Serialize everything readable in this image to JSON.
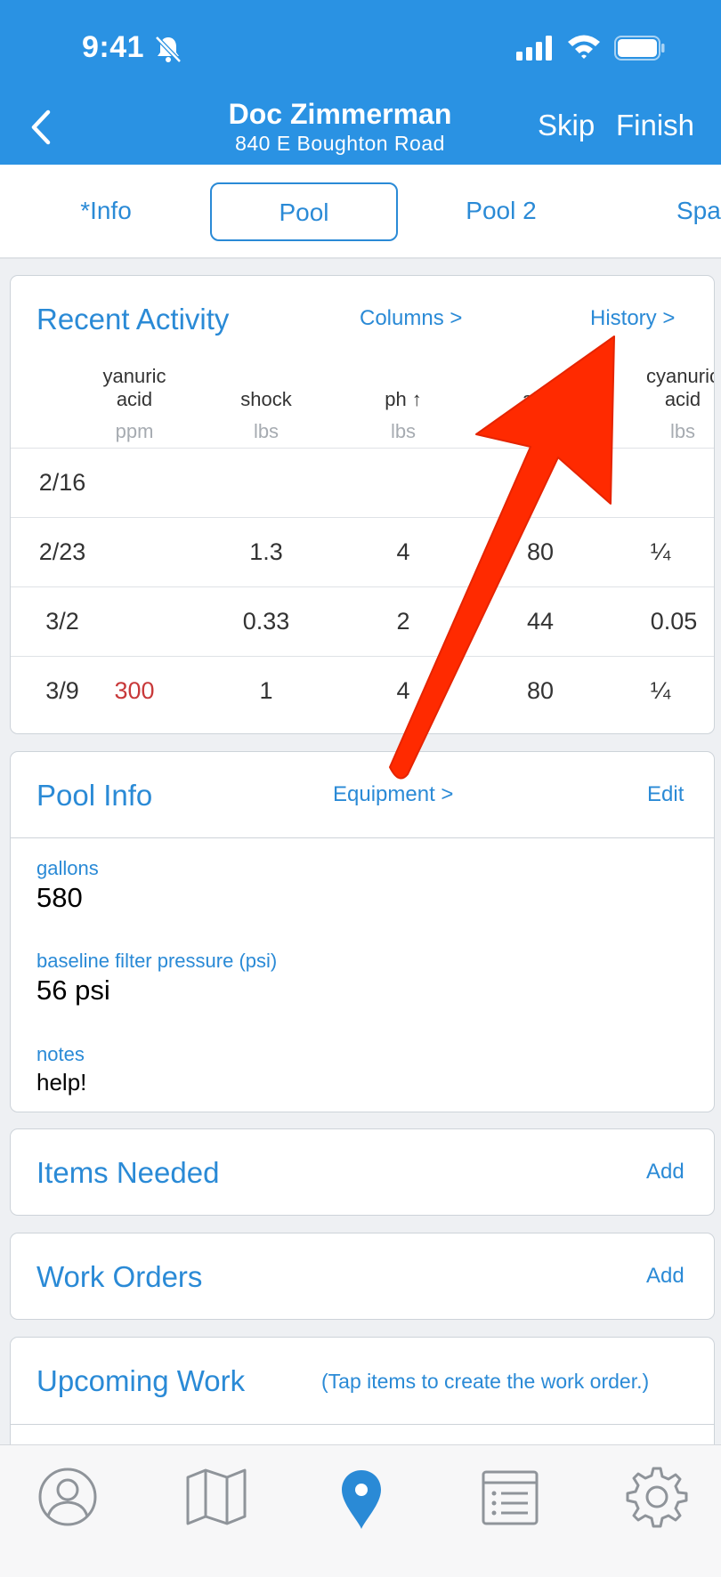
{
  "status_bar": {
    "time": "9:41"
  },
  "header": {
    "title": "Doc Zimmerman",
    "subtitle": "840 E Boughton Road",
    "skip_label": "Skip",
    "finish_label": "Finish"
  },
  "tabs": [
    "*Info",
    "Pool",
    "Pool 2",
    "Spa"
  ],
  "recent_activity": {
    "title": "Recent Activity",
    "columns_link": "Columns >",
    "history_link": "History >",
    "columns": [
      {
        "name_line1": "yanuric",
        "name_line2": "acid",
        "unit": "ppm"
      },
      {
        "name_line1": "",
        "name_line2": "shock",
        "unit": "lbs"
      },
      {
        "name_line1": "",
        "name_line2": "ph ↑",
        "unit": "lbs"
      },
      {
        "name_line1": "",
        "name_line2": "alka",
        "unit": ""
      },
      {
        "name_line1": "cyanuric",
        "name_line2": "acid",
        "unit": "lbs"
      }
    ],
    "rows": [
      {
        "date": "2/16",
        "c1": "",
        "c2": "",
        "c3": "",
        "c4": "",
        "c5": ""
      },
      {
        "date": "2/23",
        "c1": "",
        "c2": "1.3",
        "c3": "4",
        "c4": "80",
        "c5": "¼"
      },
      {
        "date": "3/2",
        "c1": "",
        "c2": "0.33",
        "c3": "2",
        "c4": "44",
        "c5": "0.05"
      },
      {
        "date": "3/9",
        "c1": "300",
        "c2": "1",
        "c3": "4",
        "c4": "80",
        "c5": "¼"
      }
    ],
    "highlight_color": "#c8393a"
  },
  "pool_info": {
    "title": "Pool Info",
    "equipment_link": "Equipment >",
    "edit_label": "Edit",
    "gallons_label": "gallons",
    "gallons_value": "580",
    "pressure_label": "baseline filter pressure (psi)",
    "pressure_value": "56 psi",
    "notes_label": "notes",
    "notes_value": "help!"
  },
  "items_needed": {
    "title": "Items Needed",
    "add_label": "Add"
  },
  "work_orders": {
    "title": "Work Orders",
    "add_label": "Add"
  },
  "upcoming_work": {
    "title": "Upcoming Work",
    "hint": "(Tap items to create the work order.)"
  },
  "tab_bar": {
    "icons": [
      "profile-icon",
      "map-icon",
      "location-pin-icon",
      "list-icon",
      "gear-icon"
    ],
    "active": "location-pin-icon"
  },
  "colors": {
    "brand": "#2a92e3",
    "link": "#2a8ad6",
    "annotation_arrow": "#ff2a00"
  }
}
